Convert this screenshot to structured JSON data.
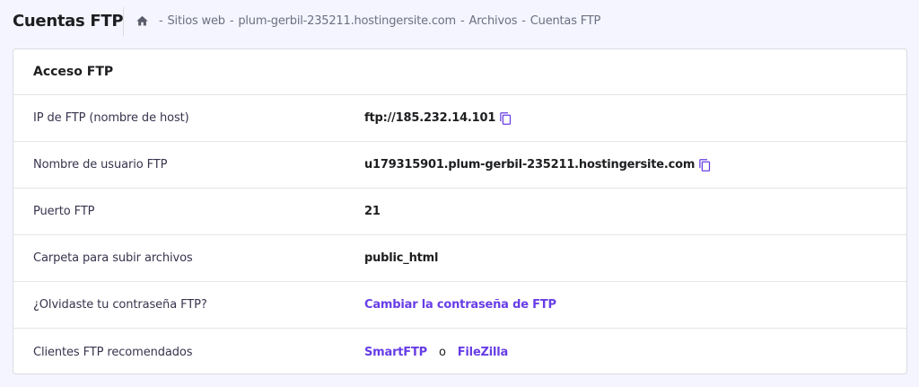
{
  "header": {
    "title": "Cuentas FTP",
    "breadcrumb": [
      {
        "label": "Sitios web"
      },
      {
        "label": "plum-gerbil-235211.hostingersite.com"
      },
      {
        "label": "Archivos"
      },
      {
        "label": "Cuentas FTP"
      }
    ],
    "separator": "-"
  },
  "card": {
    "title": "Acceso FTP",
    "rows": {
      "ip": {
        "label": "IP de FTP (nombre de host)",
        "value": "ftp://185.232.14.101"
      },
      "user": {
        "label": "Nombre de usuario FTP",
        "value": "u179315901.plum-gerbil-235211.hostingersite.com"
      },
      "port": {
        "label": "Puerto FTP",
        "value": "21"
      },
      "folder": {
        "label": "Carpeta para subir archivos",
        "value": "public_html"
      },
      "password": {
        "label": "¿Olvidaste tu contraseña FTP?",
        "link": "Cambiar la contraseña de FTP"
      },
      "clients": {
        "label": "Clientes FTP recomendados",
        "link1": "SmartFTP",
        "or": "o",
        "link2": "FileZilla"
      }
    }
  },
  "icons": {
    "home": "home-icon",
    "copy": "copy-icon"
  },
  "colors": {
    "accent": "#673de6",
    "background": "#f4f5ff",
    "text": "#1d1e20"
  }
}
